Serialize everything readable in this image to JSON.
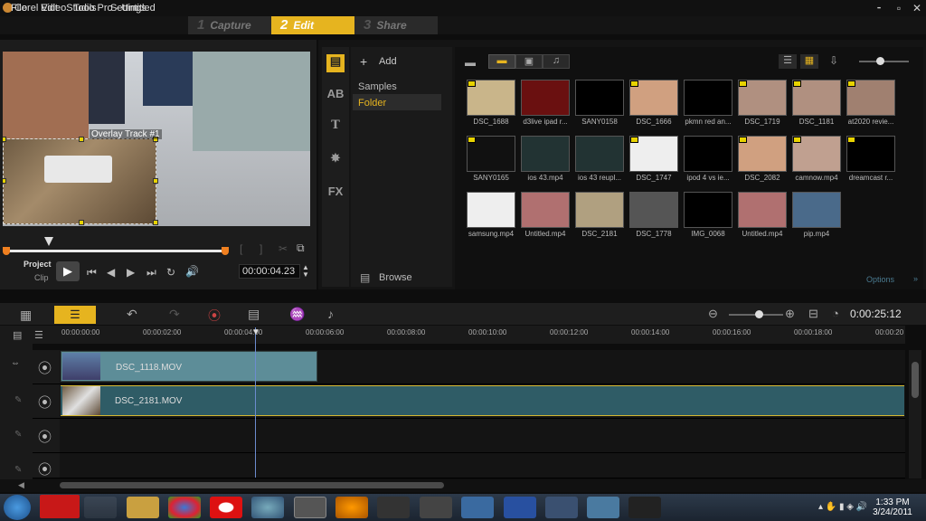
{
  "window": {
    "title": "Corel VideoStudio Pro - Untitled"
  },
  "menu": [
    "File",
    "Edit",
    "Tools",
    "Settings"
  ],
  "steps": [
    {
      "num": "1",
      "label": "Capture"
    },
    {
      "num": "2",
      "label": "Edit"
    },
    {
      "num": "3",
      "label": "Share"
    }
  ],
  "preview": {
    "overlay_label": "Overlay Track #1",
    "project_label": "Project",
    "clip_label": "Clip",
    "timecode": "00:00:04.23"
  },
  "library": {
    "add_label": "Add",
    "folders": [
      "Samples",
      "Folder"
    ],
    "browse_label": "Browse",
    "options_label": "Options",
    "side_tabs": [
      "AB",
      "T",
      "FX"
    ]
  },
  "thumbnails": [
    "DSC_1688",
    "d3live ipad r...",
    "SANY0158",
    "DSC_1666",
    "pkmn red an...",
    "DSC_1719",
    "DSC_1181",
    "at2020 revie...",
    "SANY0165",
    "ios 43.mp4",
    "ios 43 reupl...",
    "DSC_1747",
    "ipod 4 vs ie...",
    "DSC_2082",
    "camnow.mp4",
    "dreamcast r...",
    "samsung.mp4",
    "Untitled.mp4",
    "DSC_2181",
    "DSC_1778",
    "IMG_0068",
    "Untitled.mp4",
    "pip.mp4"
  ],
  "timeline": {
    "timecode": "0:00:25:12",
    "ruler": [
      "00:00:00:00",
      "00:00:02:00",
      "00:00:04:00",
      "00:00:06:00",
      "00:00:08:00",
      "00:00:10:00",
      "00:00:12:00",
      "00:00:14:00",
      "00:00:16:00",
      "00:00:18:00",
      "00:00:20"
    ],
    "clips": [
      "DSC_1118.MOV",
      "DSC_2181.MOV"
    ]
  },
  "taskbar": {
    "time": "1:33 PM",
    "date": "3/24/2011"
  }
}
